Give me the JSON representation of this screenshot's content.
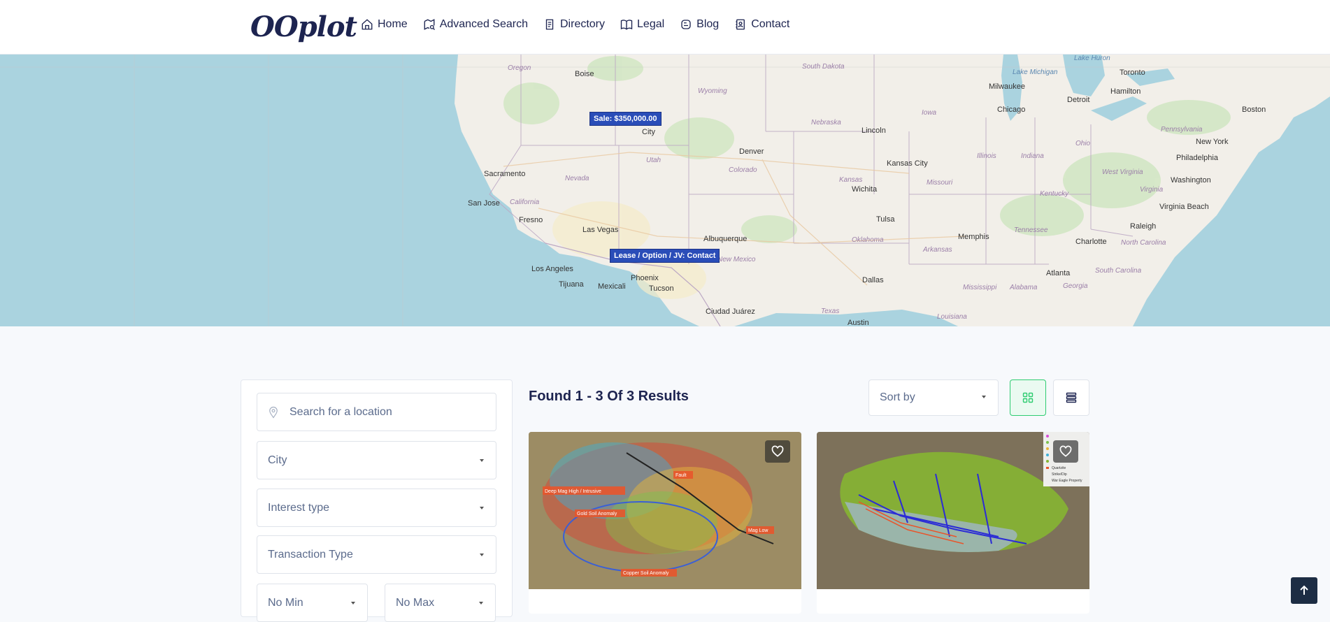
{
  "header": {
    "logo_text": "OOplot",
    "nav": [
      {
        "label": "Home",
        "icon": "home-icon"
      },
      {
        "label": "Advanced Search",
        "icon": "map-search-icon"
      },
      {
        "label": "Directory",
        "icon": "directory-icon"
      },
      {
        "label": "Legal",
        "icon": "book-icon"
      },
      {
        "label": "Blog",
        "icon": "blog-icon"
      },
      {
        "label": "Contact",
        "icon": "contact-icon"
      }
    ]
  },
  "map": {
    "cities": [
      "Boise",
      "City",
      "Denver",
      "Lincoln",
      "Kansas City",
      "Chicago",
      "Milwaukee",
      "Detroit",
      "Toronto",
      "Hamilton",
      "Boston",
      "New York",
      "Philadelphia",
      "Washington",
      "Virginia Beach",
      "Raleigh",
      "Charlotte",
      "Atlanta",
      "Memphis",
      "Tulsa",
      "Wichita",
      "Dallas",
      "Austin",
      "Albuquerque",
      "Phoenix",
      "Tucson",
      "Las Vegas",
      "Los Angeles",
      "Tijuana",
      "Mexicali",
      "Ciudad Juárez",
      "Sacramento",
      "San Jose",
      "Fresno"
    ],
    "states": [
      "Oregon",
      "Wyoming",
      "South Dakota",
      "Nebraska",
      "Iowa",
      "Utah",
      "Colorado",
      "Nevada",
      "California",
      "Kansas",
      "Missouri",
      "Illinois",
      "Indiana",
      "Ohio",
      "Pennsylvania",
      "West Virginia",
      "Virginia",
      "Kentucky",
      "Tennessee",
      "North Carolina",
      "South Carolina",
      "Georgia",
      "Alabama",
      "Mississippi",
      "Arkansas",
      "Oklahoma",
      "Texas",
      "Louisiana",
      "New Mexico"
    ],
    "water": [
      "Lake Michigan",
      "Lake Huron"
    ],
    "markers": [
      {
        "label": "Sale: $350,000.00"
      },
      {
        "label": "Lease / Option / JV: Contact"
      }
    ]
  },
  "filters": {
    "search_placeholder": "Search for a location",
    "city": "City",
    "interest_type": "Interest type",
    "transaction_type": "Transaction Type",
    "min": "No Min",
    "max": "No Max"
  },
  "results": {
    "title": "Found 1 - 3 Of 3 Results",
    "sort_label": "Sort by"
  },
  "cards": [
    {
      "labels": [
        "Deep Mag High / Intrusive",
        "Fault",
        "Gold Soil Anomaly",
        "Mag Low",
        "Copper Soil Anomaly"
      ]
    },
    {
      "legend": [
        "Quartzite",
        "Strike/Dip",
        "War Eagle Property"
      ]
    }
  ],
  "colors": {
    "accent": "#2ecc71",
    "navy": "#1d2450",
    "marker": "#2a4db8",
    "ocean": "#aad3df"
  }
}
